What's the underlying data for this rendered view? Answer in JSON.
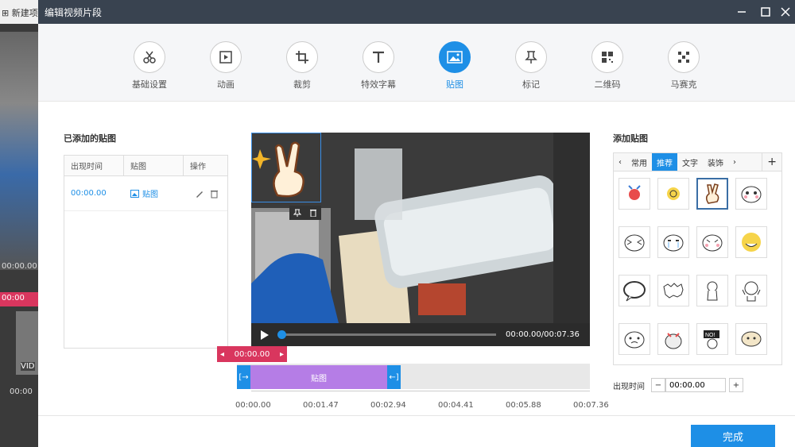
{
  "bg_app": {
    "new_label": "新建项",
    "time1": "00:00.00",
    "marker": "00:00",
    "time2": "00:00",
    "vid": "VID"
  },
  "window": {
    "title": "编辑视频片段"
  },
  "tools": [
    {
      "label": "基础设置",
      "icon": "scissors-icon"
    },
    {
      "label": "动画",
      "icon": "film-play-icon"
    },
    {
      "label": "裁剪",
      "icon": "crop-icon"
    },
    {
      "label": "特效字幕",
      "icon": "text-T-icon"
    },
    {
      "label": "贴图",
      "icon": "image-icon"
    },
    {
      "label": "标记",
      "icon": "pin-icon"
    },
    {
      "label": "二维码",
      "icon": "qrcode-icon"
    },
    {
      "label": "马赛克",
      "icon": "mosaic-icon"
    }
  ],
  "added_section": {
    "title": "已添加的贴图",
    "headers": [
      "出现时间",
      "贴图",
      "操作"
    ],
    "rows": [
      {
        "time": "00:00.00",
        "sticker": "贴图"
      }
    ]
  },
  "player": {
    "time": "00:00.00/00:07.36"
  },
  "timeline": {
    "marker": "00:00.00",
    "clip_label": "贴图",
    "ticks": [
      "00:00.00",
      "00:01.47",
      "00:02.94",
      "00:04.41",
      "00:05.88",
      "00:07.36"
    ]
  },
  "add_section": {
    "title": "添加贴图",
    "tabs": [
      "常用",
      "推荐",
      "文字",
      "装饰"
    ],
    "active_tab": "推荐",
    "appear_label": "出现时间",
    "appear_value": "00:00.00"
  },
  "done_label": "完成",
  "colors": {
    "accent": "#1e8fe6",
    "marker": "#d9365e",
    "clip": "#b57de6",
    "titlebar": "#394350"
  }
}
